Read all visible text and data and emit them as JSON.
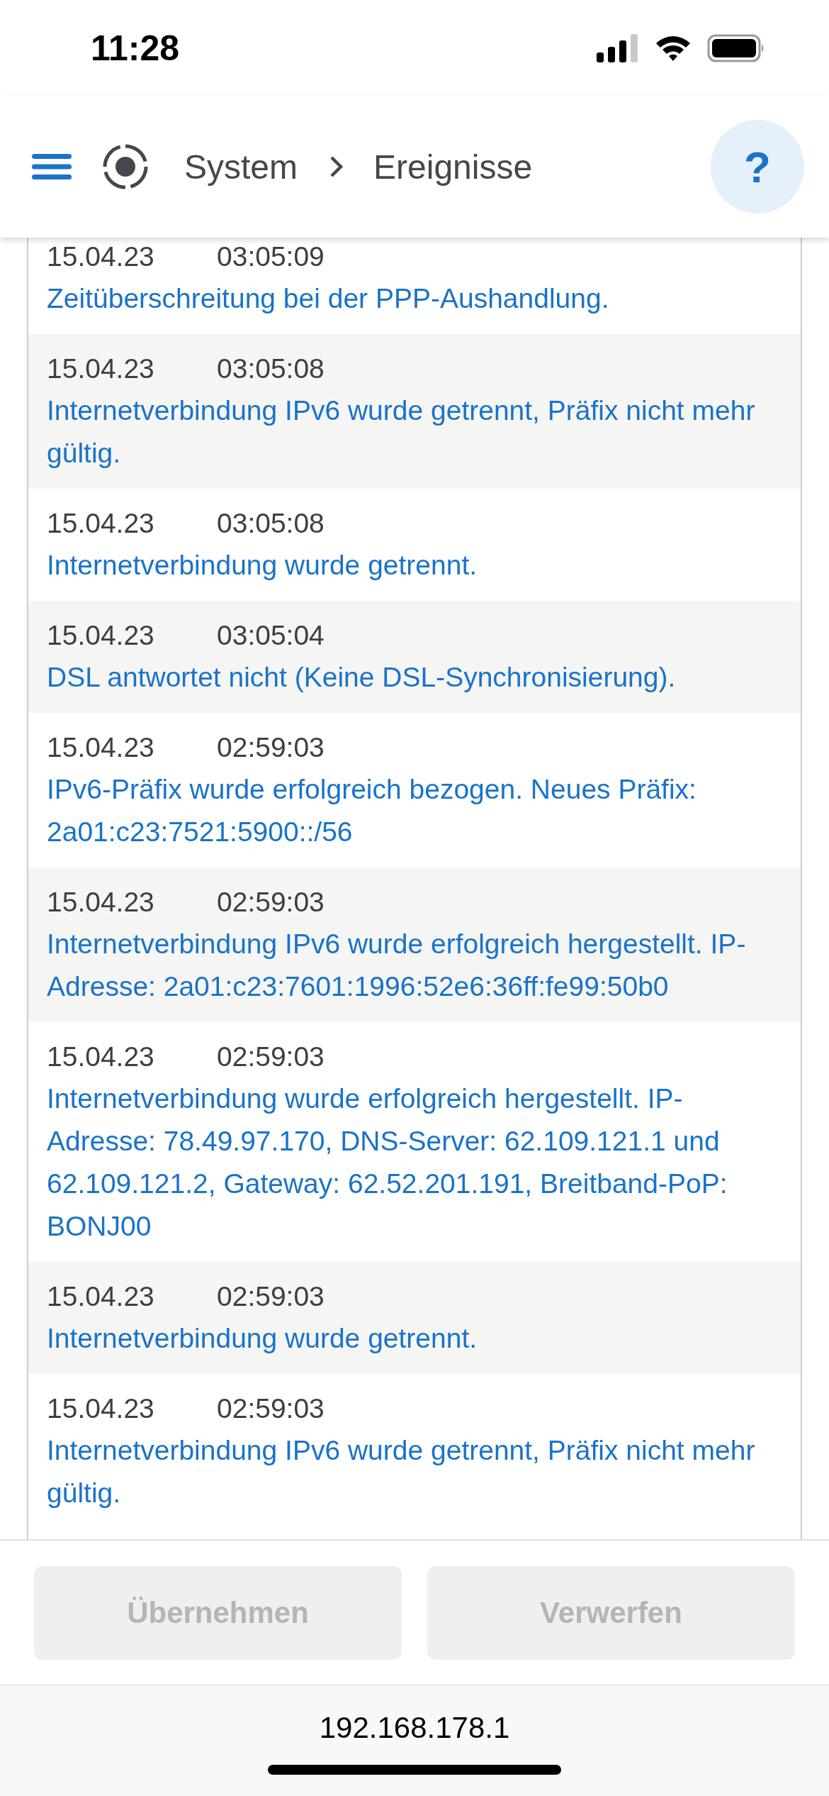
{
  "status_bar": {
    "time": "11:28"
  },
  "header": {
    "breadcrumb": [
      "System",
      "Ereignisse"
    ],
    "help": "?"
  },
  "events": [
    {
      "date": "15.04.23",
      "time": "03:05:09",
      "message": "Zeitüberschreitung bei der PPP-Aushandlung."
    },
    {
      "date": "15.04.23",
      "time": "03:05:08",
      "message": "Internetverbindung IPv6 wurde getrennt, Präfix nicht mehr gültig."
    },
    {
      "date": "15.04.23",
      "time": "03:05:08",
      "message": "Internetverbindung wurde getrennt."
    },
    {
      "date": "15.04.23",
      "time": "03:05:04",
      "message": "DSL antwortet nicht (Keine DSL-Synchronisierung)."
    },
    {
      "date": "15.04.23",
      "time": "02:59:03",
      "message": "IPv6-Präfix wurde erfolgreich bezogen. Neues Präfix: 2a01:c23:7521:5900::/56"
    },
    {
      "date": "15.04.23",
      "time": "02:59:03",
      "message": "Internetverbindung IPv6 wurde erfolgreich hergestellt. IP-Adresse: 2a01:c23:7601:1996:52e6:36ff:fe99:50b0"
    },
    {
      "date": "15.04.23",
      "time": "02:59:03",
      "message": "Internetverbindung wurde erfolgreich hergestellt. IP-Adresse: 78.49.97.170, DNS-Server: 62.109.121.1 und 62.109.121.2, Gateway: 62.52.201.191, Breitband-PoP: BONJ00"
    },
    {
      "date": "15.04.23",
      "time": "02:59:03",
      "message": "Internetverbindung wurde getrennt."
    },
    {
      "date": "15.04.23",
      "time": "02:59:03",
      "message": "Internetverbindung IPv6 wurde getrennt, Präfix nicht mehr gültig."
    }
  ],
  "buttons": [
    {
      "label": "Übernehmen",
      "disabled": true
    },
    {
      "label": "Verwerfen",
      "disabled": true
    }
  ],
  "url_bar": {
    "address": "192.168.178.1"
  }
}
